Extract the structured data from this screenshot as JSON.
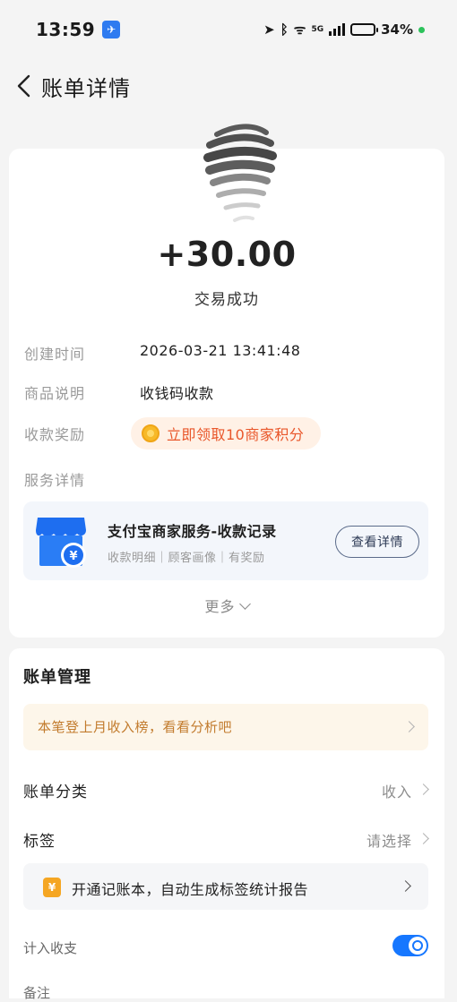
{
  "status_bar": {
    "time": "13:59",
    "network": "5G",
    "battery": "34%",
    "battery_level": 0.34
  },
  "nav": {
    "back_icon": "chevron-left-icon",
    "title": "账单详情"
  },
  "transaction": {
    "amount": "+30.00",
    "status": "交易成功"
  },
  "details": {
    "created_label": "创建时间",
    "created_value": "2026-03-21 13:41:48",
    "goods_label": "商品说明",
    "goods_value": "收钱码收款",
    "reward_label": "收款奖励",
    "reward_value": "立即领取10商家积分",
    "service_label": "服务详情"
  },
  "merchant_service": {
    "title": "支付宝商家服务-收款记录",
    "subtitle": "收款明细｜顾客画像｜有奖励",
    "button_label": "查看详情"
  },
  "more_label": "更多",
  "bill_management": {
    "title": "账单管理",
    "promo": "本笔登上月收入榜，看看分析吧",
    "category_label": "账单分类",
    "category_value": "收入",
    "tag_label": "标签",
    "tag_value": "请选择",
    "ledger_banner": "开通记账本，自动生成标签统计报告",
    "partial_row_1": "计入收支",
    "partial_row_2": "备注"
  },
  "colors": {
    "accent_blue": "#1677ff",
    "reward_orange": "#e9562a",
    "promo_text": "#c27b2d"
  }
}
